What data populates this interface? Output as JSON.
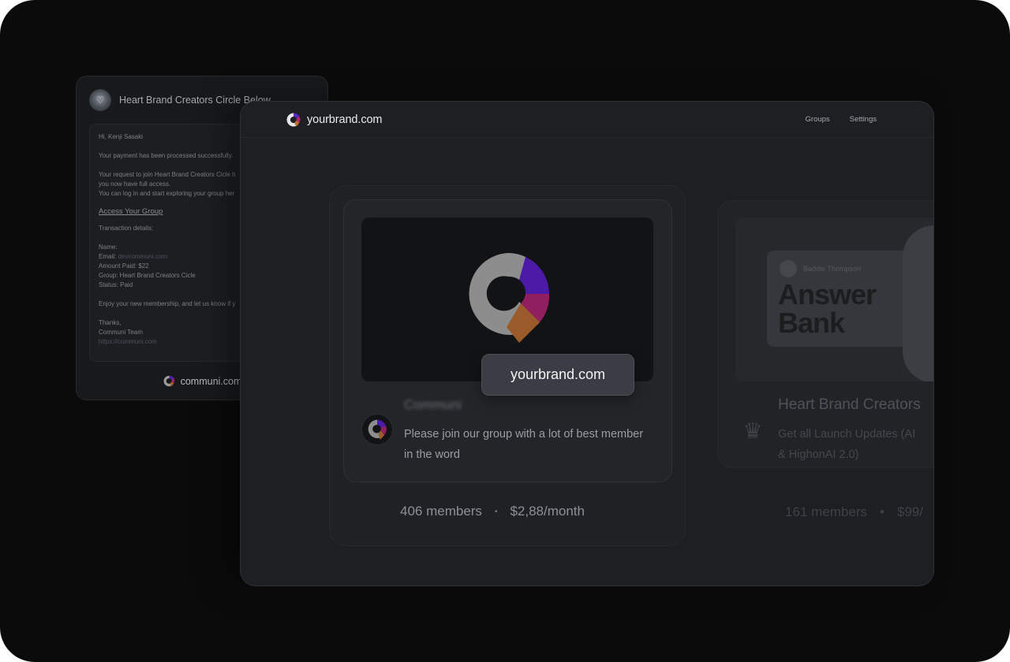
{
  "email": {
    "subject": "Heart Brand Creators Circle Below",
    "greeting": "Hi, Kenji Sasaki",
    "line_processed": "Your payment has been processed successfully.",
    "line_request_1": "Your request to join Heart Brand Creators Cicle h",
    "line_request_2": "you now have full access.",
    "line_request_3": "You can log in and start exploring your group her",
    "access_link": "Access Your Group",
    "transaction_label": "Transaction details:",
    "name_label": "Name:",
    "email_label": "Email: ",
    "email_value": "devcommuni.com",
    "amount_paid": "Amount Paid: $22",
    "group": "Group: Heart Brand Creators Cicle",
    "status": "Status: Paid",
    "closing": "Enjoy your new membership, and let us know if y",
    "thanks": "Thanks,",
    "team": "Communi Team",
    "site": "https://communi.com",
    "footer_brand": "communi.com"
  },
  "header": {
    "brand": "yourbrand.com",
    "nav": [
      "Groups",
      "Settings"
    ]
  },
  "group_card": {
    "tooltip": "yourbrand.com",
    "name": "Communi",
    "description": "Please join our group with a lot of best member in the word",
    "members": "406 members",
    "separator": "•",
    "price": "$2,88/month"
  },
  "group_card_right": {
    "cover_author": "Baddie Thompson",
    "cover_title_1": "Answer",
    "cover_title_2": "Bank",
    "title": "Heart Brand Creators",
    "description_1": "Get all Launch Updates (AI",
    "description_2": "& HighonAI 2.0)",
    "members": "161 members",
    "separator": "•",
    "price": "$99/"
  },
  "logo_colors": {
    "gray": "#8d8d8d",
    "purple": "#4b1aa6",
    "magenta": "#8f1f5e",
    "orange": "#9a5a2a"
  }
}
